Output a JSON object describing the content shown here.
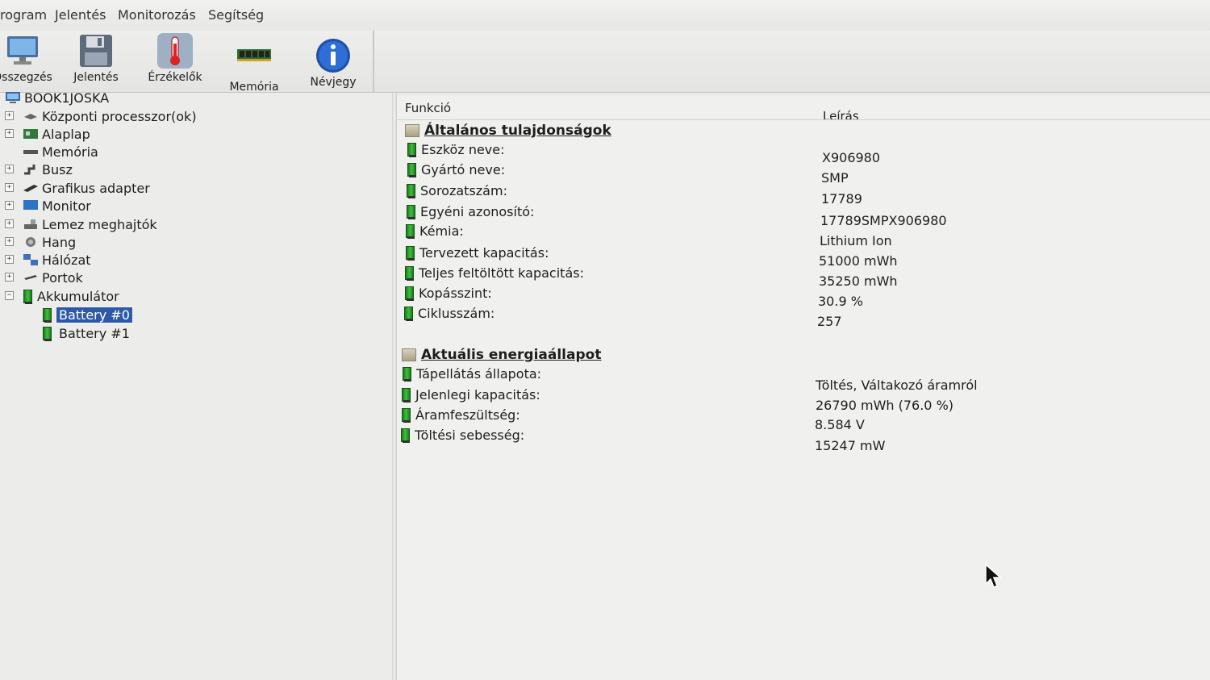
{
  "menu": [
    "rogram",
    "Jelentés",
    "Monitorozás",
    "Segítség"
  ],
  "toolbar": [
    {
      "label": "Összegzés",
      "icon": "monitor-icon"
    },
    {
      "label": "Jelentés",
      "icon": "floppy-icon"
    },
    {
      "label": "Érzékelők",
      "icon": "thermometer-icon"
    },
    {
      "label": "Memória",
      "icon": "memory-module-icon"
    },
    {
      "label": "Névjegy",
      "icon": "info-icon"
    }
  ],
  "tree": {
    "root": "BOOK1JOSKA",
    "items": [
      {
        "label": "Központi processzor(ok)",
        "icon": "cpu-icon",
        "expander": "+"
      },
      {
        "label": "Alaplap",
        "icon": "motherboard-icon",
        "expander": "+"
      },
      {
        "label": "Memória",
        "icon": "ram-icon",
        "expander": ""
      },
      {
        "label": "Busz",
        "icon": "bus-icon",
        "expander": "+"
      },
      {
        "label": "Grafikus adapter",
        "icon": "gpu-icon",
        "expander": "+"
      },
      {
        "label": "Monitor",
        "icon": "monitor-icon",
        "expander": "+"
      },
      {
        "label": "Lemez meghajtók",
        "icon": "disk-icon",
        "expander": "+"
      },
      {
        "label": "Hang",
        "icon": "speaker-icon",
        "expander": "+"
      },
      {
        "label": "Hálózat",
        "icon": "network-icon",
        "expander": "+"
      },
      {
        "label": "Portok",
        "icon": "port-icon",
        "expander": "+"
      },
      {
        "label": "Akkumulátor",
        "icon": "battery-icon",
        "expander": "−"
      }
    ],
    "children": [
      {
        "label": "Battery #0",
        "icon": "battery-icon"
      },
      {
        "label": "Battery #1",
        "icon": "battery-icon"
      }
    ]
  },
  "details": {
    "col_function": "Funkció",
    "col_description": "Leírás",
    "sections": [
      {
        "title": "Általános tulajdonságok",
        "rows": [
          {
            "label": "Eszköz neve:",
            "value": "X906980"
          },
          {
            "label": "Gyártó neve:",
            "value": "SMP"
          },
          {
            "label": "Sorozatszám:",
            "value": "17789"
          },
          {
            "label": "Egyéni azonosító:",
            "value": "17789SMPX906980"
          },
          {
            "label": "Kémia:",
            "value": "Lithium Ion"
          },
          {
            "label": "Tervezett kapacitás:",
            "value": "51000 mWh"
          },
          {
            "label": "Teljes feltöltött kapacitás:",
            "value": "35250 mWh"
          },
          {
            "label": "Kopásszint:",
            "value": "30.9 %"
          },
          {
            "label": "Ciklusszám:",
            "value": "257"
          }
        ]
      },
      {
        "title": "Aktuális energiaállapot",
        "rows": [
          {
            "label": "Tápellátás állapota:",
            "value": "Töltés, Váltakozó áramról"
          },
          {
            "label": "Jelenlegi kapacitás:",
            "value": "26790 mWh (76.0 %)"
          },
          {
            "label": "Áramfeszültség:",
            "value": "8.584 V"
          },
          {
            "label": "Töltési sebesség:",
            "value": "15247 mW"
          }
        ]
      }
    ]
  }
}
